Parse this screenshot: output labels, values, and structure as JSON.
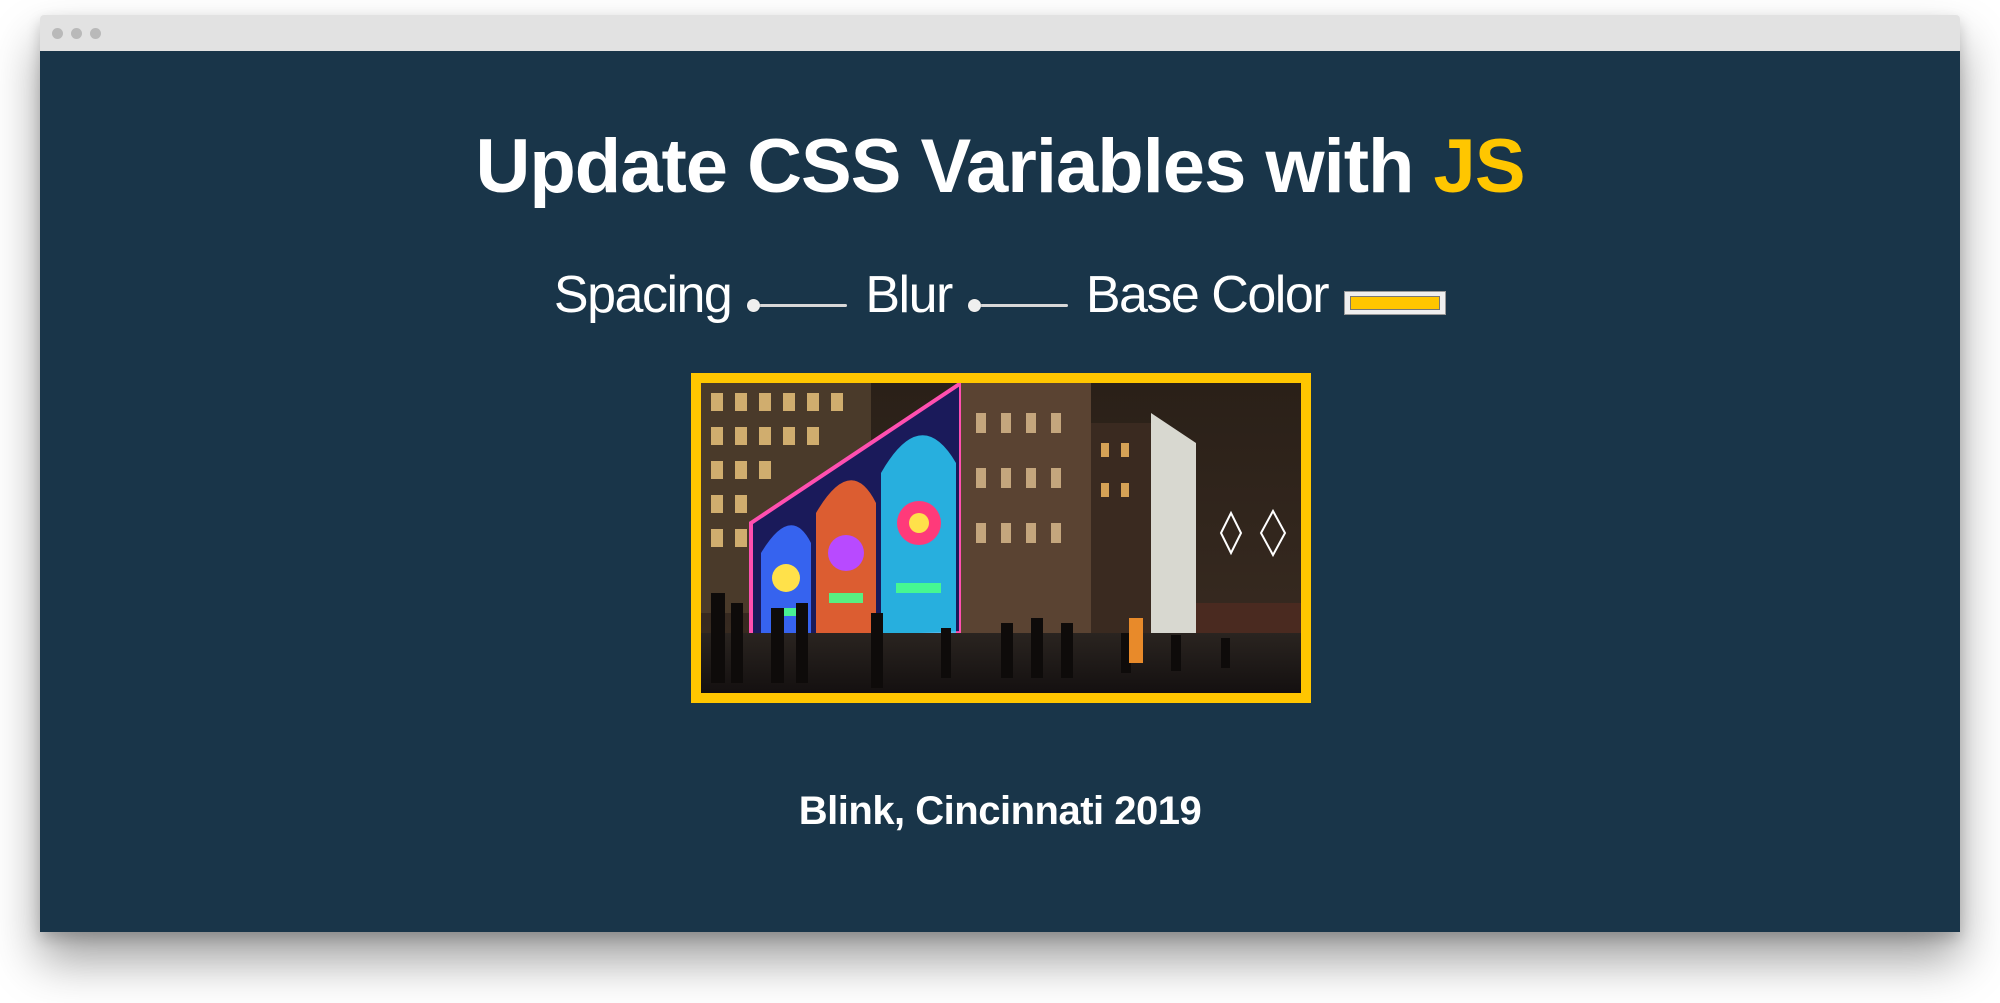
{
  "page": {
    "heading_main": "Update CSS Variables with ",
    "heading_highlight": "JS",
    "caption": "Blink, Cincinnati 2019"
  },
  "controls": {
    "spacing": {
      "label": "Spacing",
      "value": 0
    },
    "blur": {
      "label": "Blur",
      "value": 0
    },
    "base_color": {
      "label": "Base Color",
      "value": "#ffc600"
    }
  },
  "photo": {
    "description_icon": "photo-icon"
  },
  "colors": {
    "background": "#193549",
    "accent": "#ffc600",
    "text": "#ffffff",
    "window_titlebar": "#e2e2e2"
  }
}
